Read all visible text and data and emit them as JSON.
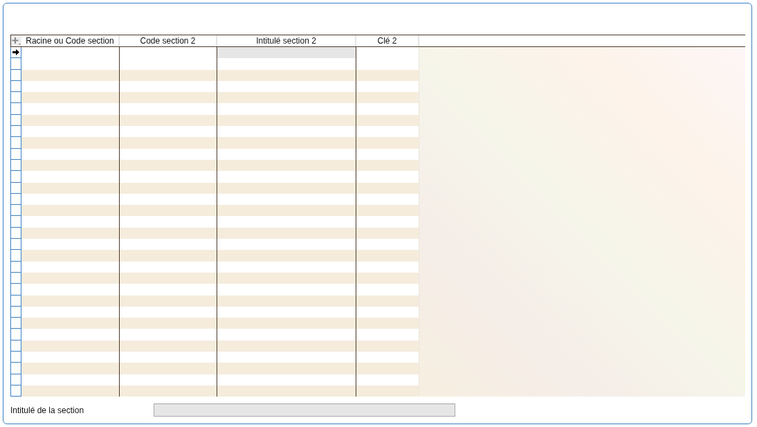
{
  "grid": {
    "columns": [
      {
        "label": "Racine ou Code section",
        "focused": false
      },
      {
        "label": "Code section 2",
        "focused": false
      },
      {
        "label": "Intitulé section 2",
        "focused": true
      },
      {
        "label": "Clé 2",
        "focused": false
      }
    ],
    "rows": [
      {
        "selected": true
      },
      {
        "selected": false
      },
      {
        "selected": false
      },
      {
        "selected": false
      },
      {
        "selected": false
      },
      {
        "selected": false
      },
      {
        "selected": false
      },
      {
        "selected": false
      },
      {
        "selected": false
      },
      {
        "selected": false
      },
      {
        "selected": false
      },
      {
        "selected": false
      },
      {
        "selected": false
      },
      {
        "selected": false
      },
      {
        "selected": false
      },
      {
        "selected": false
      },
      {
        "selected": false
      },
      {
        "selected": false
      },
      {
        "selected": false
      },
      {
        "selected": false
      },
      {
        "selected": false
      },
      {
        "selected": false
      },
      {
        "selected": false
      },
      {
        "selected": false
      },
      {
        "selected": false
      },
      {
        "selected": false
      },
      {
        "selected": false
      },
      {
        "selected": false
      },
      {
        "selected": false
      },
      {
        "selected": false
      },
      {
        "selected": false
      }
    ]
  },
  "section_field": {
    "label": "Intitulé de la section",
    "disabled": true
  }
}
